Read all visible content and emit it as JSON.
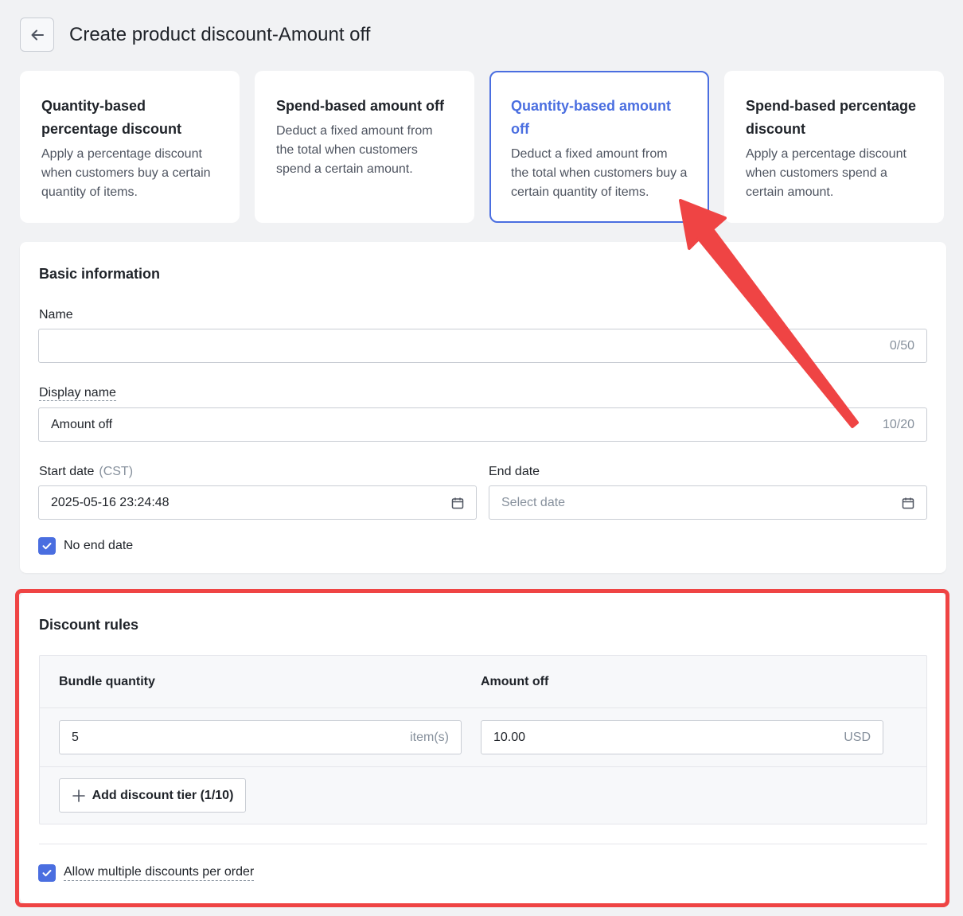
{
  "header": {
    "title": "Create product discount-Amount off"
  },
  "type_cards": [
    {
      "title": "Quantity-based percentage discount",
      "desc": "Apply a percentage discount when customers buy a certain quantity of items.",
      "selected": false
    },
    {
      "title": "Spend-based amount off",
      "desc": "Deduct a fixed amount from the total when customers spend a certain amount.",
      "selected": false
    },
    {
      "title": "Quantity-based amount off",
      "desc": "Deduct a fixed amount from the total when customers buy a certain quantity of items.",
      "selected": true
    },
    {
      "title": "Spend-based percentage discount",
      "desc": "Apply a percentage discount when customers spend a certain amount.",
      "selected": false
    }
  ],
  "basic": {
    "title": "Basic information",
    "name_label": "Name",
    "name_value": "",
    "name_count": "0/50",
    "display_label": "Display name",
    "display_value": "Amount off",
    "display_count": "10/20",
    "start_label": "Start date",
    "start_tz": "(CST)",
    "start_value": "2025-05-16 23:24:48",
    "end_label": "End date",
    "end_placeholder": "Select date",
    "no_end_label": "No end date",
    "no_end_checked": true
  },
  "rules": {
    "title": "Discount rules",
    "col_qty": "Bundle quantity",
    "col_amount": "Amount off",
    "qty_value": "5",
    "qty_suffix": "item(s)",
    "amount_value": "10.00",
    "amount_suffix": "USD",
    "add_tier_label": "Add discount tier (1/10)",
    "allow_multiple_label": "Allow multiple discounts per order",
    "allow_multiple_checked": true
  },
  "colors": {
    "accent": "#4a6ee0",
    "annotation": "#ef4444",
    "background": "#f1f2f4"
  }
}
